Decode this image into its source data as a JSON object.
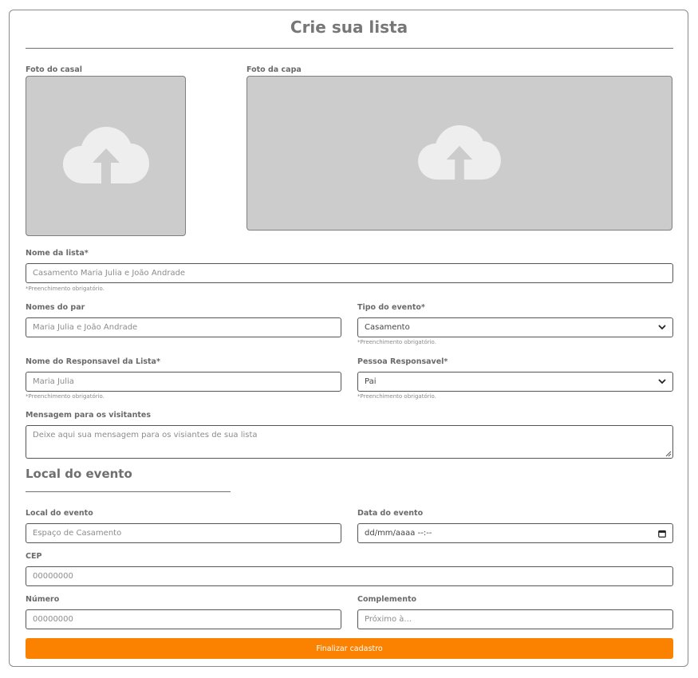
{
  "form": {
    "title": "Crie sua lista",
    "submit_label": "Finalizar cadastro"
  },
  "photos": {
    "couple_label": "Foto do casal",
    "cover_label": "Foto da capa",
    "upload_icon": "cloud-upload-icon"
  },
  "fields": {
    "list_name": {
      "label": "Nome da lista*",
      "placeholder": "Casamento Maria Julia e João Andrade",
      "hint": "*Preenchimento obrigatório."
    },
    "couple_names": {
      "label": "Nomes do par",
      "placeholder": "Maria Julia e João Andrade"
    },
    "event_type": {
      "label": "Tipo do evento*",
      "value": "Casamento",
      "hint": "*Preenchimento obrigatório."
    },
    "responsible_name": {
      "label": "Nome do Responsavel da Lista*",
      "placeholder": "Maria Julia",
      "hint": "*Preenchimento obrigatório."
    },
    "responsible_person": {
      "label": "Pessoa Responsavel*",
      "value": "Pai",
      "hint": "*Preenchimento obrigatório."
    },
    "message": {
      "label": "Mensagem para os visitantes",
      "placeholder": "Deixe aqui sua mensagem para os visiantes de sua lista"
    }
  },
  "location": {
    "section_title": "Local do evento",
    "venue": {
      "label": "Local do evento",
      "placeholder": "Espaço de Casamento"
    },
    "date": {
      "label": "Data do evento",
      "value": "dd/mm/aaaa --:--"
    },
    "cep": {
      "label": "CEP",
      "placeholder": "00000000"
    },
    "number": {
      "label": "Número",
      "placeholder": "00000000"
    },
    "complement": {
      "label": "Complemento",
      "placeholder": "Próximo à..."
    }
  },
  "colors": {
    "accent": "#fb8200",
    "photo_bg": "#cccccc",
    "icon": "#eeeeee"
  }
}
